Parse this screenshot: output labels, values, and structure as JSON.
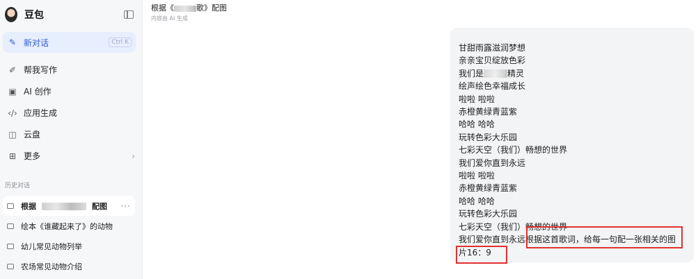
{
  "sidebar": {
    "brand": "豆包",
    "new_chat": {
      "label": "新对话",
      "shortcut": "Ctrl K"
    },
    "items": [
      {
        "label": "帮我写作",
        "icon": "pen-icon"
      },
      {
        "label": "AI 创作",
        "icon": "image-icon"
      },
      {
        "label": "应用生成",
        "icon": "code-icon"
      },
      {
        "label": "云盘",
        "icon": "cloud-drive-icon"
      },
      {
        "label": "更多",
        "icon": "grid-icon"
      }
    ],
    "history_title": "历史对话",
    "history": [
      {
        "prefix": "根据",
        "suffix": "配图",
        "more": "···"
      },
      {
        "label": "绘本《谁藏起来了》的动物"
      },
      {
        "label": "幼儿常见动物列举"
      },
      {
        "label": "农场常见动物介绍"
      }
    ]
  },
  "header": {
    "title_prefix": "根据《",
    "title_suffix": "歌》配图",
    "subtitle": "内容由 AI 生成"
  },
  "message": {
    "lines": [
      "甘甜雨露滋润梦想",
      "亲亲宝贝绽放色彩",
      "我们是",
      "绘声绘色幸福成长",
      "啦啦 啦啦",
      "赤橙黄绿青蓝紫",
      "哈哈 哈哈",
      "玩转色彩大乐园",
      "七彩天空（我们）畅想的世界",
      "我们爱你直到永远",
      "啦啦 啦啦",
      "赤橙黄绿青蓝紫",
      "哈哈 哈哈",
      "玩转色彩大乐园",
      "七彩天空（我们）畅想的世界"
    ],
    "line3_suffix": "精灵",
    "last_line": "我们爱你直到永远",
    "request": "根据这首歌词，给每一句配一张相关的图",
    "request_tail": "片16：9"
  },
  "colors": {
    "accent": "#2d5bd9",
    "highlight": "#e0312d"
  }
}
